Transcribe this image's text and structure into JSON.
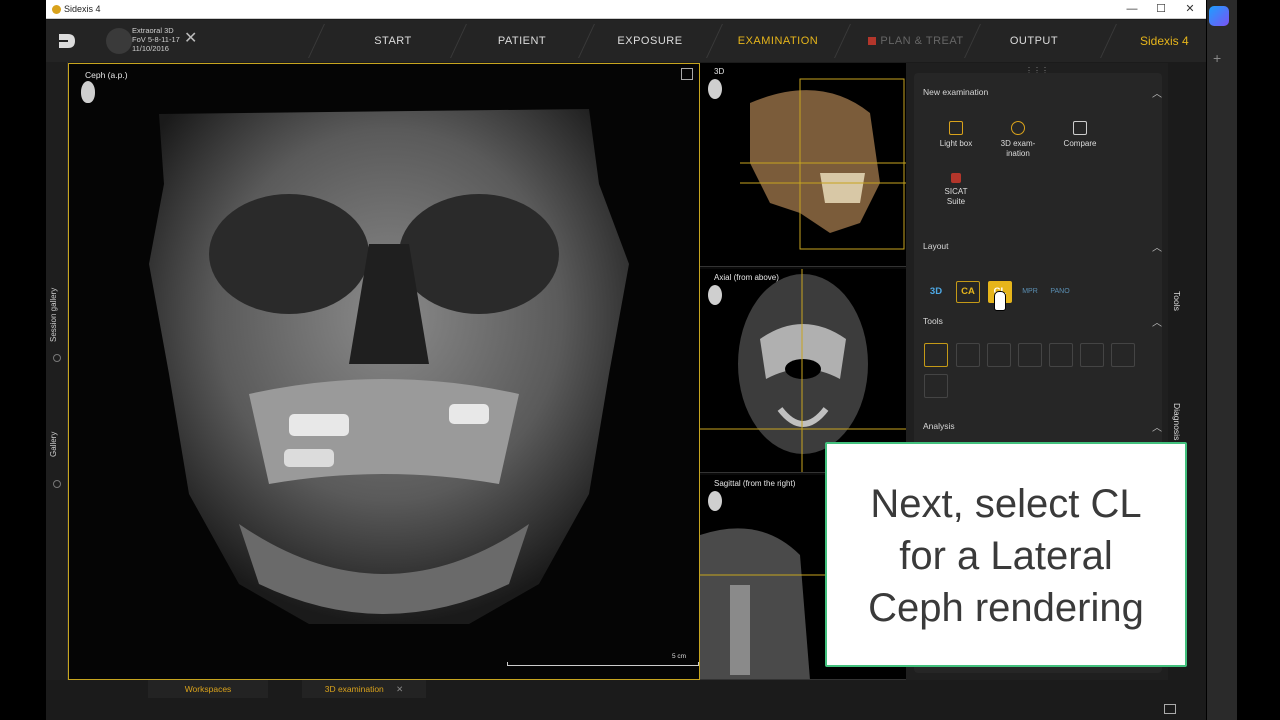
{
  "window": {
    "title": "Sidexis 4",
    "min_label": "—",
    "max_label": "☐",
    "close_label": "✕"
  },
  "appbar": {
    "patient_line1": "Extraoral 3D",
    "patient_line2": "FoV 5-8-11-17",
    "patient_line3": "11/10/2016",
    "close_label": "✕",
    "nav": [
      {
        "label": "START"
      },
      {
        "label": "PATIENT"
      },
      {
        "label": "EXPOSURE"
      },
      {
        "label": "EXAMINATION"
      },
      {
        "label": "PLAN & TREAT"
      },
      {
        "label": "OUTPUT"
      }
    ],
    "brand": "Sidexis 4"
  },
  "leftrail": {
    "session_gallery": "Session gallery",
    "gallery": "Gallery"
  },
  "mainview": {
    "label": "Ceph (a.p.)",
    "scale_label": "5 cm"
  },
  "right_panels": {
    "p3d": "3D",
    "axial": "Axial (from above)",
    "sagittal": "Sagittal (from the right)"
  },
  "sidebar": {
    "new_exam_header": "New examination",
    "tiles": [
      {
        "label1": "Light box",
        "label2": ""
      },
      {
        "label1": "3D exam-",
        "label2": "ination"
      },
      {
        "label1": "Compare",
        "label2": ""
      },
      {
        "label1": "SICAT",
        "label2": "Suite"
      }
    ],
    "layout_header": "Layout",
    "layouts": [
      "3D",
      "CA",
      "CL",
      "MPR",
      "PANO"
    ],
    "tools_header": "Tools",
    "analysis_header": "Analysis"
  },
  "right_tabs": {
    "tools": "Tools",
    "diagnosis": "Diagnosis"
  },
  "bottom": {
    "workspaces": "Workspaces",
    "exam_tab": "3D examination",
    "exam_close": "✕"
  },
  "toast": {
    "line1": "Next, select CL",
    "line2": "for a Lateral",
    "line3": "Ceph rendering"
  },
  "colors": {
    "accent": "#e6b51b",
    "toast_border": "#42c07d",
    "layout_blue": "#4ea9e6"
  }
}
